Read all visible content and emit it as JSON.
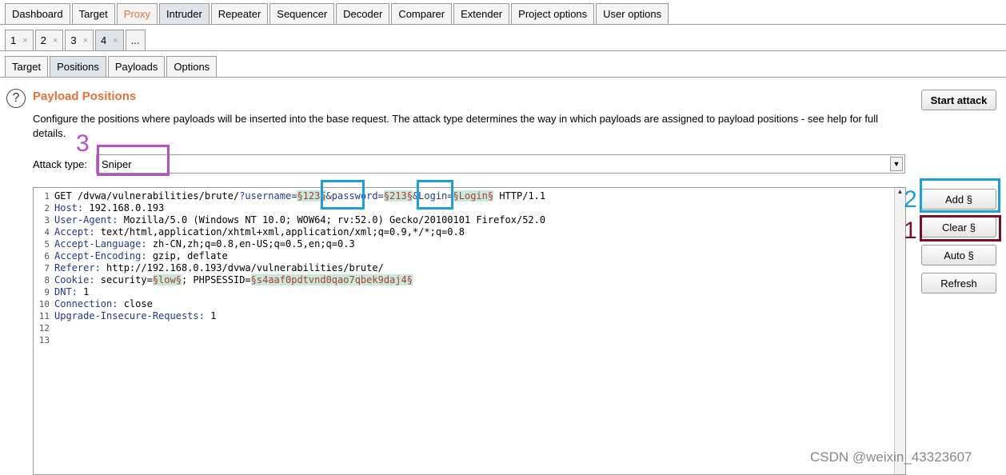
{
  "main_tabs": [
    "Dashboard",
    "Target",
    "Proxy",
    "Intruder",
    "Repeater",
    "Sequencer",
    "Decoder",
    "Comparer",
    "Extender",
    "Project options",
    "User options"
  ],
  "attack_tabs": [
    {
      "label": "1",
      "close": "×"
    },
    {
      "label": "2",
      "close": "×"
    },
    {
      "label": "3",
      "close": "×"
    },
    {
      "label": "4",
      "close": "×"
    },
    {
      "label": "..."
    }
  ],
  "sub_tabs": [
    "Target",
    "Positions",
    "Payloads",
    "Options"
  ],
  "help_icon": "?",
  "section_title": "Payload Positions",
  "description": "Configure the positions where payloads will be inserted into the base request. The attack type determines the way in which payloads are assigned to payload positions - see help for full details.",
  "attack_type": {
    "label": "Attack type:",
    "value": "Sniper"
  },
  "buttons": {
    "start": "Start attack",
    "add": "Add §",
    "clear": "Clear §",
    "auto": "Auto §",
    "refresh": "Refresh"
  },
  "request_lines": [
    "GET /dvwa/vulnerabilities/brute/?username=§123§&password=§213§&Login=§Login§ HTTP/1.1",
    "Host: 192.168.0.193",
    "User-Agent: Mozilla/5.0 (Windows NT 10.0; WOW64; rv:52.0) Gecko/20100101 Firefox/52.0",
    "Accept: text/html,application/xhtml+xml,application/xml;q=0.9,*/*;q=0.8",
    "Accept-Language: zh-CN,zh;q=0.8,en-US;q=0.5,en;q=0.3",
    "Accept-Encoding: gzip, deflate",
    "Referer: http://192.168.0.193/dvwa/vulnerabilities/brute/",
    "Cookie: security=§low§; PHPSESSID=§s4aaf0pdtvnd0qao7qbek9daj4§",
    "DNT: 1",
    "Connection: close",
    "Upgrade-Insecure-Requests: 1",
    "",
    ""
  ],
  "annotations": {
    "n1": "1",
    "n2": "2",
    "n3": "3"
  },
  "annotation_colors": {
    "blue": "#1a9fe0",
    "maroon": "#7a1028",
    "purple": "#b84fc8"
  },
  "watermark": "CSDN @weixin_43323607"
}
